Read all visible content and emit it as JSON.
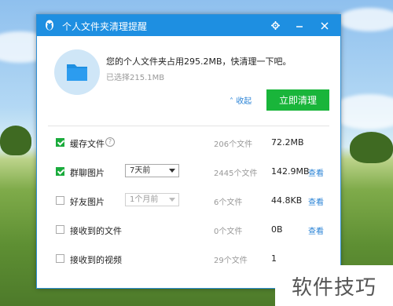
{
  "window": {
    "title": "个人文件夹清理提醒"
  },
  "header": {
    "message": "您的个人文件夹占用295.2MB，快清理一下吧。",
    "selected": "已选择215.1MB",
    "collapse_label": "收起",
    "clean_button": "立即清理"
  },
  "rows": [
    {
      "label": "缓存文件",
      "checked": true,
      "count": "206个文件",
      "size": "72.2MB",
      "view": ""
    },
    {
      "label": "群聊图片",
      "checked": true,
      "select": "7天前",
      "count": "2445个文件",
      "size": "142.9MB",
      "view": "查看"
    },
    {
      "label": "好友图片",
      "checked": false,
      "select": "1个月前",
      "count": "6个文件",
      "size": "44.8KB",
      "view": "查看"
    },
    {
      "label": "接收到的文件",
      "checked": false,
      "count": "0个文件",
      "size": "0B",
      "view": "查看"
    },
    {
      "label": "接收到的视频",
      "checked": false,
      "count": "29个文件",
      "size": "1",
      "view": ""
    }
  ],
  "watermark": "软件技巧",
  "colors": {
    "titlebar": "#1e8fe1",
    "accent_green": "#19b53a",
    "link_blue": "#2a83d6"
  }
}
